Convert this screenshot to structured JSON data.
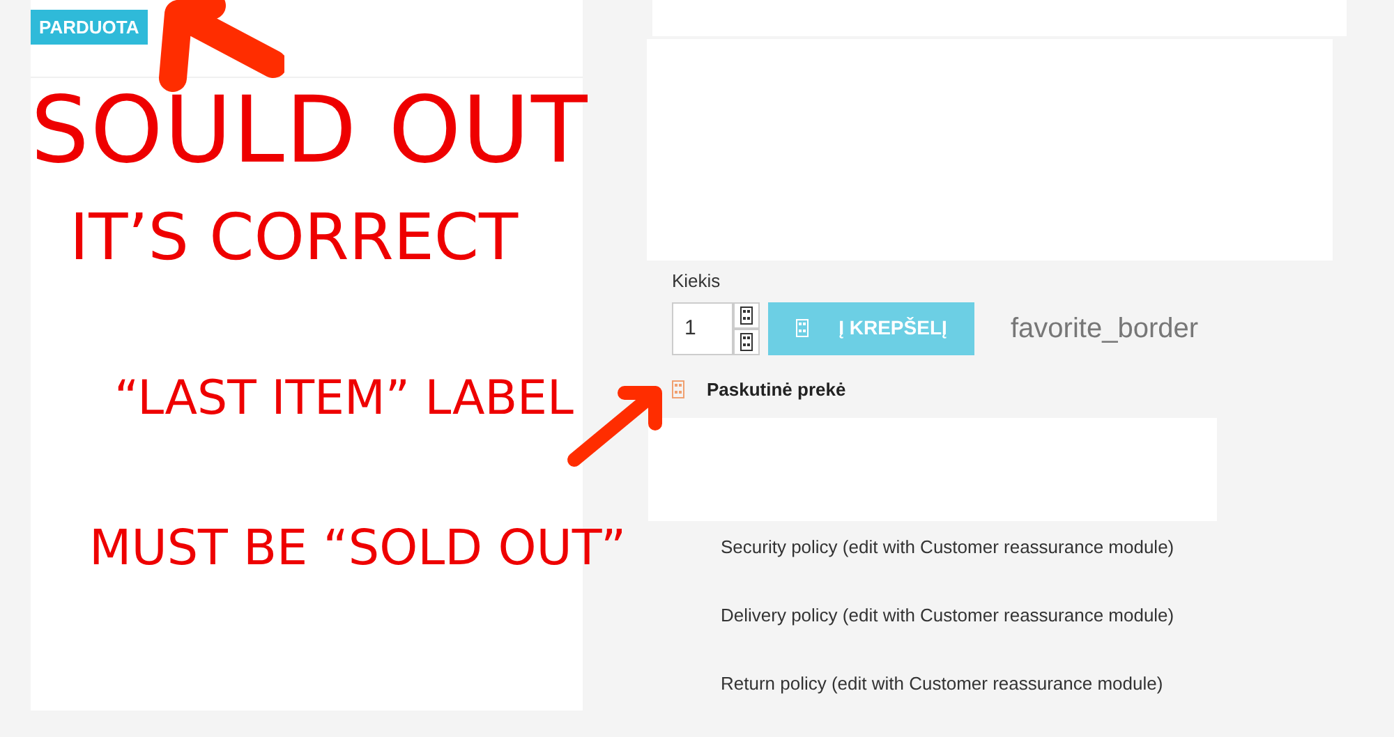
{
  "product_flag": "PARDUOTA",
  "quantity": {
    "label": "Kiekis",
    "value": "1"
  },
  "add_to_cart": "Į KREPŠELĮ",
  "wishlist": "favorite_border",
  "availability": "Paskutinė prekė",
  "policies": [
    "Security policy (edit with Customer reassurance module)",
    "Delivery policy (edit with Customer reassurance module)",
    "Return policy (edit with Customer reassurance module)"
  ],
  "annotations": [
    "SOULD OUT",
    "IT’S CORRECT",
    "“LAST ITEM” LABEL",
    "MUST BE “SOLD OUT”"
  ]
}
